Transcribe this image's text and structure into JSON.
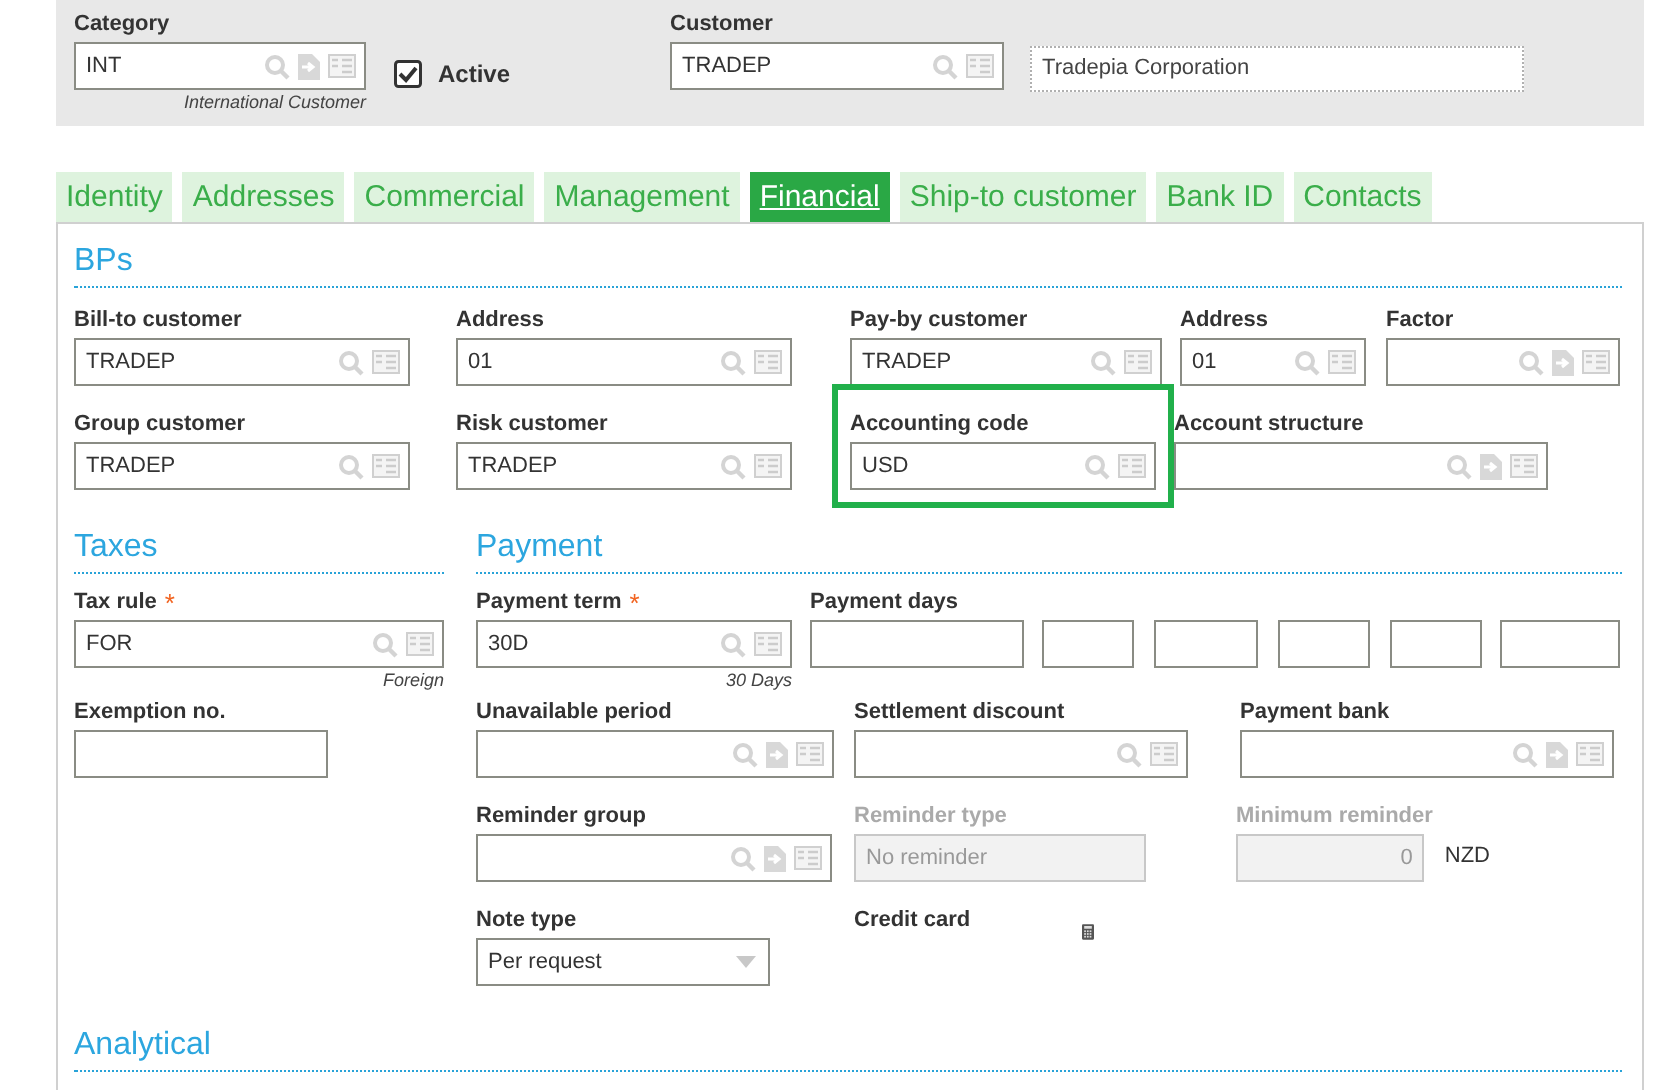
{
  "header": {
    "fields": [
      {
        "kind": "lookup_jump",
        "label": "Category",
        "value": "INT",
        "caption": "International Customer"
      },
      {
        "kind": "checkbox",
        "label": "Active",
        "checked": true
      },
      {
        "kind": "lookup",
        "label": "Customer",
        "value": "TRADEP"
      },
      {
        "kind": "display",
        "value": "Tradepia Corporation"
      }
    ]
  },
  "tabs": [
    {
      "label": "Identity",
      "selected": false
    },
    {
      "label": "Addresses",
      "selected": false
    },
    {
      "label": "Commercial",
      "selected": false
    },
    {
      "label": "Management",
      "selected": false
    },
    {
      "label": "Financial",
      "selected": true
    },
    {
      "label": "Ship-to customer",
      "selected": false
    },
    {
      "label": "Bank ID",
      "selected": false
    },
    {
      "label": "Contacts",
      "selected": false
    }
  ],
  "bps": {
    "title": "BPs",
    "rows": [
      [
        {
          "kind": "lookup",
          "label": "Bill-to customer",
          "value": "TRADEP",
          "disabled": false,
          "highlighted": false
        },
        {
          "kind": "lookup",
          "label": "Address",
          "value": "01",
          "disabled": false,
          "highlighted": false
        },
        {
          "kind": "lookup",
          "label": "Pay-by customer",
          "value": "TRADEP",
          "disabled": false,
          "highlighted": false
        },
        {
          "kind": "lookup",
          "label": "Address",
          "value": "01",
          "disabled": false,
          "highlighted": false
        },
        {
          "kind": "lookup_jump",
          "label": "Factor",
          "disabled": false,
          "highlighted": false
        }
      ],
      [
        {
          "kind": "lookup",
          "label": "Group customer",
          "value": "TRADEP",
          "disabled": false,
          "highlighted": false
        },
        {
          "kind": "lookup",
          "label": "Risk customer",
          "value": "TRADEP",
          "disabled": false,
          "highlighted": false
        },
        {
          "kind": "lookup",
          "label": "Accounting code",
          "value": "USD",
          "disabled": false,
          "highlighted": true
        },
        {
          "kind": "lookup_jump",
          "label": "Account structure",
          "disabled": false,
          "highlighted": false
        }
      ]
    ]
  },
  "taxes": {
    "title": "Taxes",
    "rows": [
      [
        {
          "kind": "lookup",
          "label": "Tax rule",
          "value": "FOR",
          "caption": "Foreign",
          "marker": "*",
          "disabled": false,
          "highlighted": false
        }
      ],
      [
        {
          "kind": "text",
          "label": "Exemption no.",
          "disabled": false,
          "highlighted": false
        }
      ]
    ]
  },
  "payment": {
    "title": "Payment",
    "rows": [
      [
        {
          "kind": "lookup",
          "label": "Payment term",
          "value": "30D",
          "caption": "30 Days",
          "marker": "*",
          "disabled": false,
          "highlighted": false
        },
        {
          "kind": "days",
          "label": "Payment days",
          "disabled": false,
          "highlighted": false
        }
      ],
      [
        {
          "kind": "lookup_jump",
          "label": "Unavailable period",
          "disabled": false,
          "highlighted": false
        },
        {
          "kind": "lookup",
          "label": "Settlement discount",
          "disabled": false,
          "highlighted": false
        },
        {
          "kind": "lookup_jump",
          "label": "Payment bank",
          "disabled": false,
          "highlighted": false
        }
      ],
      [
        {
          "kind": "lookup_jump",
          "label": "Reminder group",
          "disabled": false,
          "highlighted": false
        },
        {
          "kind": "text",
          "label": "Reminder type",
          "value": "No reminder",
          "disabled": true,
          "highlighted": false
        },
        {
          "kind": "number",
          "label": "Minimum reminder",
          "value": "0",
          "unit": "NZD",
          "disabled": true,
          "highlighted": false
        }
      ],
      [
        {
          "kind": "select",
          "label": "Note type",
          "value": "Per request",
          "disabled": false,
          "highlighted": false
        },
        {
          "kind": "calculator",
          "label": "Credit card",
          "disabled": false,
          "highlighted": false
        }
      ]
    ]
  },
  "analytical": {
    "title": "Analytical"
  }
}
